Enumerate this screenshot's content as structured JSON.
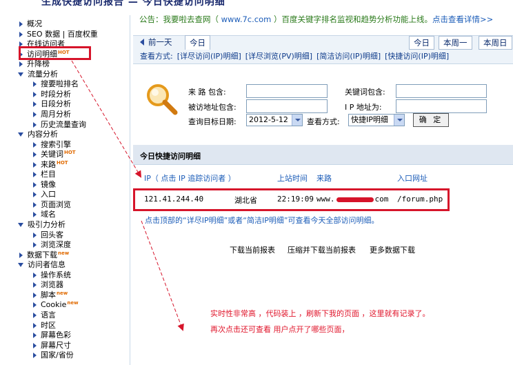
{
  "page_title": "生成快捷访问报告 — 今日快捷访问明细",
  "sidebar": {
    "items": [
      {
        "label": "概况",
        "type": "item",
        "level": 0,
        "badge": ""
      },
      {
        "label": "SEO 数据 | 百度权重",
        "type": "item",
        "level": 0,
        "badge": ""
      },
      {
        "label": "在线访问者",
        "type": "item",
        "level": 0,
        "badge": ""
      },
      {
        "label": "访问明细",
        "type": "item",
        "level": 0,
        "badge": "HOT"
      },
      {
        "label": "升降榜",
        "type": "item",
        "level": 0,
        "badge": ""
      },
      {
        "label": "流量分析",
        "type": "group",
        "level": 0,
        "badge": ""
      },
      {
        "label": "搜要啦排名",
        "type": "item",
        "level": 1,
        "badge": ""
      },
      {
        "label": "时段分析",
        "type": "item",
        "level": 1,
        "badge": ""
      },
      {
        "label": "日段分析",
        "type": "item",
        "level": 1,
        "badge": ""
      },
      {
        "label": "周月分析",
        "type": "item",
        "level": 1,
        "badge": ""
      },
      {
        "label": "历史流量查询",
        "type": "item",
        "level": 1,
        "badge": ""
      },
      {
        "label": "内容分析",
        "type": "group",
        "level": 0,
        "badge": ""
      },
      {
        "label": "搜索引擎",
        "type": "item",
        "level": 1,
        "badge": ""
      },
      {
        "label": "关键词",
        "type": "item",
        "level": 1,
        "badge": "HOT"
      },
      {
        "label": "来路",
        "type": "item",
        "level": 1,
        "badge": "HOT"
      },
      {
        "label": "栏目",
        "type": "item",
        "level": 1,
        "badge": ""
      },
      {
        "label": "镜像",
        "type": "item",
        "level": 1,
        "badge": ""
      },
      {
        "label": "入口",
        "type": "item",
        "level": 1,
        "badge": ""
      },
      {
        "label": "页面浏览",
        "type": "item",
        "level": 1,
        "badge": ""
      },
      {
        "label": "域名",
        "type": "item",
        "level": 1,
        "badge": ""
      },
      {
        "label": "吸引力分析",
        "type": "group",
        "level": 0,
        "badge": ""
      },
      {
        "label": "回头客",
        "type": "item",
        "level": 1,
        "badge": ""
      },
      {
        "label": "浏览深度",
        "type": "item",
        "level": 1,
        "badge": ""
      },
      {
        "label": "数据下载",
        "type": "item",
        "level": 0,
        "badge": "new"
      },
      {
        "label": "访问者信息",
        "type": "group",
        "level": 0,
        "badge": ""
      },
      {
        "label": "操作系统",
        "type": "item",
        "level": 1,
        "badge": ""
      },
      {
        "label": "浏览器",
        "type": "item",
        "level": 1,
        "badge": ""
      },
      {
        "label": "脚本",
        "type": "item",
        "level": 1,
        "badge": "new"
      },
      {
        "label": "Cookie",
        "type": "item",
        "level": 1,
        "badge": "new"
      },
      {
        "label": "语言",
        "type": "item",
        "level": 1,
        "badge": ""
      },
      {
        "label": "时区",
        "type": "item",
        "level": 1,
        "badge": ""
      },
      {
        "label": "屏幕色彩",
        "type": "item",
        "level": 1,
        "badge": ""
      },
      {
        "label": "屏幕尺寸",
        "type": "item",
        "level": 1,
        "badge": ""
      },
      {
        "label": "国家/省份",
        "type": "item",
        "level": 1,
        "badge": ""
      }
    ]
  },
  "notice": {
    "prefix": "公告：我要啦去查网（",
    "domain": " www.7c.com ",
    "suffix": "）百度关键字排名监视和趋势分析功能上线。",
    "link": "点击查看详情>>"
  },
  "nav": {
    "prev_day": "前一天",
    "today_tab": "今日",
    "right_buttons": [
      "今日",
      "本周一",
      "本周日"
    ],
    "view_label": "查看方式:",
    "view_modes": [
      "[详尽访问(IP)明细]",
      "[详尽浏览(PV)明细]",
      "[简洁访问(IP)明细]",
      "[快捷访问(IP)明细]"
    ]
  },
  "filter": {
    "referrer_label": "来 路 包含:",
    "keyword_label": "关键词包含:",
    "visited_label": "被访地址包含:",
    "ip_label": "I P 地址为:",
    "date_label": "查询目标日期:",
    "date_value": "2012-5-12",
    "mode_label": "查看方式:",
    "mode_value": "快捷IP明细",
    "confirm": "确 定"
  },
  "visits": {
    "title": "今日快捷访问明细",
    "columns": {
      "ip": "IP（ 点击 IP 追踪访问者 ）",
      "time": "上站时间",
      "referrer": "来路",
      "entry": "入口网址"
    },
    "rows": [
      {
        "ip": "121.41.244.40",
        "location": "湖北省",
        "time": "22:19:09",
        "referrer_prefix": "www.",
        "referrer_suffix": "com",
        "entry": "/forum.php"
      }
    ],
    "hint": "点击顶部的“详尽IP明细”或者“简洁IP明细”可查看今天全部访问明细。",
    "downloads": [
      "下载当前报表",
      "压缩并下载当前报表",
      "更多数据下载"
    ]
  },
  "annotation": {
    "line1": "实时性非常高 ，代码装上 ，刷新下我的页面 ，这里就有记录了。",
    "line2": "再次点击还可查看 用户点开了哪些页面，",
    "color": "#e0142a"
  }
}
